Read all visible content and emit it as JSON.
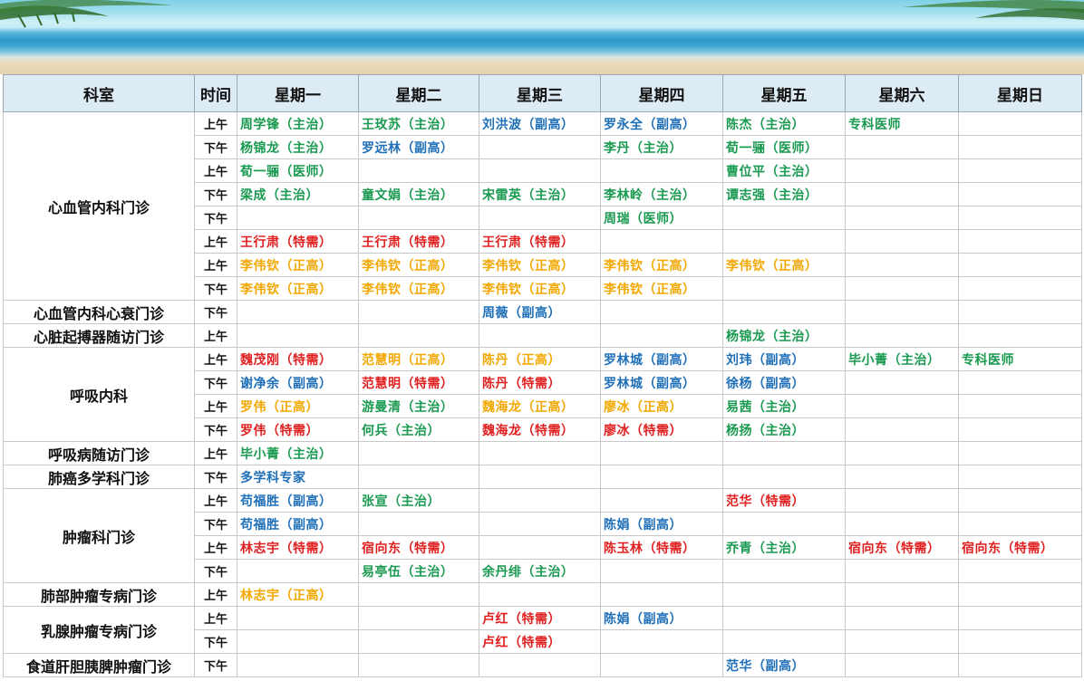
{
  "colors": {
    "header_bg": "#dcebf4",
    "green": "#1a9a50",
    "blue": "#1e6fb8",
    "red": "#e02020",
    "orange": "#f2a800"
  },
  "banner": {
    "icon": "beach-banner-image"
  },
  "headers": [
    "科室",
    "时间",
    "星期一",
    "星期二",
    "星期三",
    "星期四",
    "星期五",
    "星期六",
    "星期日"
  ],
  "departments": [
    {
      "name": "心血管内科门诊",
      "rows": [
        {
          "time": "上午",
          "cells": [
            {
              "t": "周学锋（主治）",
              "c": "green"
            },
            {
              "t": "王玫苏（主治）",
              "c": "green"
            },
            {
              "t": "刘洪波（副高）",
              "c": "blue"
            },
            {
              "t": "罗永全（副高）",
              "c": "blue"
            },
            {
              "t": "陈杰（主治）",
              "c": "green"
            },
            {
              "t": "专科医师",
              "c": "green"
            },
            {
              "t": "",
              "c": ""
            }
          ]
        },
        {
          "time": "下午",
          "cells": [
            {
              "t": "杨锦龙（主治）",
              "c": "green"
            },
            {
              "t": "罗远林（副高）",
              "c": "blue"
            },
            {
              "t": "",
              "c": ""
            },
            {
              "t": "李丹（主治）",
              "c": "green"
            },
            {
              "t": "荀一骊（医师）",
              "c": "green"
            },
            {
              "t": "",
              "c": ""
            },
            {
              "t": "",
              "c": ""
            }
          ]
        },
        {
          "time": "上午",
          "cells": [
            {
              "t": "荀一骊（医师）",
              "c": "green"
            },
            {
              "t": "",
              "c": ""
            },
            {
              "t": "",
              "c": ""
            },
            {
              "t": "",
              "c": ""
            },
            {
              "t": "曹位平（主治）",
              "c": "green"
            },
            {
              "t": "",
              "c": ""
            },
            {
              "t": "",
              "c": ""
            }
          ]
        },
        {
          "time": "下午",
          "cells": [
            {
              "t": "梁成（主治）",
              "c": "green"
            },
            {
              "t": "童文娟（主治）",
              "c": "green"
            },
            {
              "t": "宋雷英（主治）",
              "c": "green"
            },
            {
              "t": "李林岭（主治）",
              "c": "green"
            },
            {
              "t": "谭志强（主治）",
              "c": "green"
            },
            {
              "t": "",
              "c": ""
            },
            {
              "t": "",
              "c": ""
            }
          ]
        },
        {
          "time": "下午",
          "cells": [
            {
              "t": "",
              "c": ""
            },
            {
              "t": "",
              "c": ""
            },
            {
              "t": "",
              "c": ""
            },
            {
              "t": "周瑞（医师）",
              "c": "green"
            },
            {
              "t": "",
              "c": ""
            },
            {
              "t": "",
              "c": ""
            },
            {
              "t": "",
              "c": ""
            }
          ]
        },
        {
          "time": "上午",
          "cells": [
            {
              "t": "王行肃（特需）",
              "c": "red"
            },
            {
              "t": "王行肃（特需）",
              "c": "red"
            },
            {
              "t": "王行肃（特需）",
              "c": "red"
            },
            {
              "t": "",
              "c": ""
            },
            {
              "t": "",
              "c": ""
            },
            {
              "t": "",
              "c": ""
            },
            {
              "t": "",
              "c": ""
            }
          ]
        },
        {
          "time": "上午",
          "cells": [
            {
              "t": "李伟钦（正高）",
              "c": "orange"
            },
            {
              "t": "李伟钦（正高）",
              "c": "orange"
            },
            {
              "t": "李伟钦（正高）",
              "c": "orange"
            },
            {
              "t": "李伟钦（正高）",
              "c": "orange"
            },
            {
              "t": "李伟钦（正高）",
              "c": "orange"
            },
            {
              "t": "",
              "c": ""
            },
            {
              "t": "",
              "c": ""
            }
          ]
        },
        {
          "time": "下午",
          "cells": [
            {
              "t": "李伟钦（正高）",
              "c": "orange"
            },
            {
              "t": "李伟钦（正高）",
              "c": "orange"
            },
            {
              "t": "李伟钦（正高）",
              "c": "orange"
            },
            {
              "t": "李伟钦（正高）",
              "c": "orange"
            },
            {
              "t": "",
              "c": ""
            },
            {
              "t": "",
              "c": ""
            },
            {
              "t": "",
              "c": ""
            }
          ]
        }
      ]
    },
    {
      "name": "心血管内科心衰门诊",
      "rows": [
        {
          "time": "下午",
          "cells": [
            {
              "t": "",
              "c": ""
            },
            {
              "t": "",
              "c": ""
            },
            {
              "t": "周薇（副高）",
              "c": "blue"
            },
            {
              "t": "",
              "c": ""
            },
            {
              "t": "",
              "c": ""
            },
            {
              "t": "",
              "c": ""
            },
            {
              "t": "",
              "c": ""
            }
          ]
        }
      ]
    },
    {
      "name": "心脏起搏器随访门诊",
      "rows": [
        {
          "time": "上午",
          "cells": [
            {
              "t": "",
              "c": ""
            },
            {
              "t": "",
              "c": ""
            },
            {
              "t": "",
              "c": ""
            },
            {
              "t": "",
              "c": ""
            },
            {
              "t": "杨锦龙（主治）",
              "c": "green"
            },
            {
              "t": "",
              "c": ""
            },
            {
              "t": "",
              "c": ""
            }
          ]
        }
      ]
    },
    {
      "name": "呼吸内科",
      "rows": [
        {
          "time": "上午",
          "cells": [
            {
              "t": "魏茂刚（特需）",
              "c": "red"
            },
            {
              "t": "范慧明（正高）",
              "c": "orange"
            },
            {
              "t": "陈丹（正高）",
              "c": "orange"
            },
            {
              "t": "罗林城（副高）",
              "c": "blue"
            },
            {
              "t": "刘玮（副高）",
              "c": "blue"
            },
            {
              "t": "毕小菁（主治）",
              "c": "green"
            },
            {
              "t": "专科医师",
              "c": "green"
            }
          ]
        },
        {
          "time": "下午",
          "cells": [
            {
              "t": "谢净余（副高）",
              "c": "blue"
            },
            {
              "t": "范慧明（特需）",
              "c": "red"
            },
            {
              "t": "陈丹（特需）",
              "c": "red"
            },
            {
              "t": "罗林城（副高）",
              "c": "blue"
            },
            {
              "t": "徐杨（副高）",
              "c": "blue"
            },
            {
              "t": "",
              "c": ""
            },
            {
              "t": "",
              "c": ""
            }
          ]
        },
        {
          "time": "上午",
          "cells": [
            {
              "t": "罗伟（正高）",
              "c": "orange"
            },
            {
              "t": "游曼清（主治）",
              "c": "green"
            },
            {
              "t": "魏海龙（正高）",
              "c": "orange"
            },
            {
              "t": "廖冰（正高）",
              "c": "orange"
            },
            {
              "t": "易茜（主治）",
              "c": "green"
            },
            {
              "t": "",
              "c": ""
            },
            {
              "t": "",
              "c": ""
            }
          ]
        },
        {
          "time": "下午",
          "cells": [
            {
              "t": "罗伟（特需）",
              "c": "red"
            },
            {
              "t": "何兵（主治）",
              "c": "green"
            },
            {
              "t": "魏海龙（特需）",
              "c": "red"
            },
            {
              "t": "廖冰（特需）",
              "c": "red"
            },
            {
              "t": "杨扬（主治）",
              "c": "green"
            },
            {
              "t": "",
              "c": ""
            },
            {
              "t": "",
              "c": ""
            }
          ]
        }
      ]
    },
    {
      "name": "呼吸病随访门诊",
      "rows": [
        {
          "time": "上午",
          "cells": [
            {
              "t": "毕小菁（主治）",
              "c": "green"
            },
            {
              "t": "",
              "c": ""
            },
            {
              "t": "",
              "c": ""
            },
            {
              "t": "",
              "c": ""
            },
            {
              "t": "",
              "c": ""
            },
            {
              "t": "",
              "c": ""
            },
            {
              "t": "",
              "c": ""
            }
          ]
        }
      ]
    },
    {
      "name": "肺癌多学科门诊",
      "rows": [
        {
          "time": "下午",
          "cells": [
            {
              "t": "多学科专家",
              "c": "blue"
            },
            {
              "t": "",
              "c": ""
            },
            {
              "t": "",
              "c": ""
            },
            {
              "t": "",
              "c": ""
            },
            {
              "t": "",
              "c": ""
            },
            {
              "t": "",
              "c": ""
            },
            {
              "t": "",
              "c": ""
            }
          ]
        }
      ]
    },
    {
      "name": "肿瘤科门诊",
      "rows": [
        {
          "time": "上午",
          "cells": [
            {
              "t": "苟福胜（副高）",
              "c": "blue"
            },
            {
              "t": "张宣（主治）",
              "c": "green"
            },
            {
              "t": "",
              "c": ""
            },
            {
              "t": "",
              "c": ""
            },
            {
              "t": "范华（特需）",
              "c": "red"
            },
            {
              "t": "",
              "c": ""
            },
            {
              "t": "",
              "c": ""
            }
          ]
        },
        {
          "time": "下午",
          "cells": [
            {
              "t": "苟福胜（副高）",
              "c": "blue"
            },
            {
              "t": "",
              "c": ""
            },
            {
              "t": "",
              "c": ""
            },
            {
              "t": "陈娟（副高）",
              "c": "blue"
            },
            {
              "t": "",
              "c": ""
            },
            {
              "t": "",
              "c": ""
            },
            {
              "t": "",
              "c": ""
            }
          ]
        },
        {
          "time": "上午",
          "cells": [
            {
              "t": "林志宇（特需）",
              "c": "red"
            },
            {
              "t": "宿向东（特需）",
              "c": "red"
            },
            {
              "t": "",
              "c": ""
            },
            {
              "t": "陈玉林（特需）",
              "c": "red"
            },
            {
              "t": "乔青（主治）",
              "c": "green"
            },
            {
              "t": "宿向东（特需）",
              "c": "red"
            },
            {
              "t": "宿向东（特需）",
              "c": "red"
            }
          ]
        },
        {
          "time": "下午",
          "cells": [
            {
              "t": "",
              "c": ""
            },
            {
              "t": "易亭伍（主治）",
              "c": "green"
            },
            {
              "t": "余丹绯（主治）",
              "c": "green"
            },
            {
              "t": "",
              "c": ""
            },
            {
              "t": "",
              "c": ""
            },
            {
              "t": "",
              "c": ""
            },
            {
              "t": "",
              "c": ""
            }
          ]
        }
      ]
    },
    {
      "name": "肺部肿瘤专病门诊",
      "rows": [
        {
          "time": "上午",
          "cells": [
            {
              "t": "林志宇（正高）",
              "c": "orange"
            },
            {
              "t": "",
              "c": ""
            },
            {
              "t": "",
              "c": ""
            },
            {
              "t": "",
              "c": ""
            },
            {
              "t": "",
              "c": ""
            },
            {
              "t": "",
              "c": ""
            },
            {
              "t": "",
              "c": ""
            }
          ]
        }
      ]
    },
    {
      "name": "乳腺肿瘤专病门诊",
      "rows": [
        {
          "time": "上午",
          "cells": [
            {
              "t": "",
              "c": ""
            },
            {
              "t": "",
              "c": ""
            },
            {
              "t": "卢红（特需）",
              "c": "red"
            },
            {
              "t": "陈娟（副高）",
              "c": "blue"
            },
            {
              "t": "",
              "c": ""
            },
            {
              "t": "",
              "c": ""
            },
            {
              "t": "",
              "c": ""
            }
          ]
        },
        {
          "time": "下午",
          "cells": [
            {
              "t": "",
              "c": ""
            },
            {
              "t": "",
              "c": ""
            },
            {
              "t": "卢红（特需）",
              "c": "red"
            },
            {
              "t": "",
              "c": ""
            },
            {
              "t": "",
              "c": ""
            },
            {
              "t": "",
              "c": ""
            },
            {
              "t": "",
              "c": ""
            }
          ]
        }
      ]
    },
    {
      "name": "食道肝胆胰脾肿瘤门诊",
      "rows": [
        {
          "time": "下午",
          "cells": [
            {
              "t": "",
              "c": ""
            },
            {
              "t": "",
              "c": ""
            },
            {
              "t": "",
              "c": ""
            },
            {
              "t": "",
              "c": ""
            },
            {
              "t": "范华（副高）",
              "c": "blue"
            },
            {
              "t": "",
              "c": ""
            },
            {
              "t": "",
              "c": ""
            }
          ]
        }
      ]
    }
  ]
}
